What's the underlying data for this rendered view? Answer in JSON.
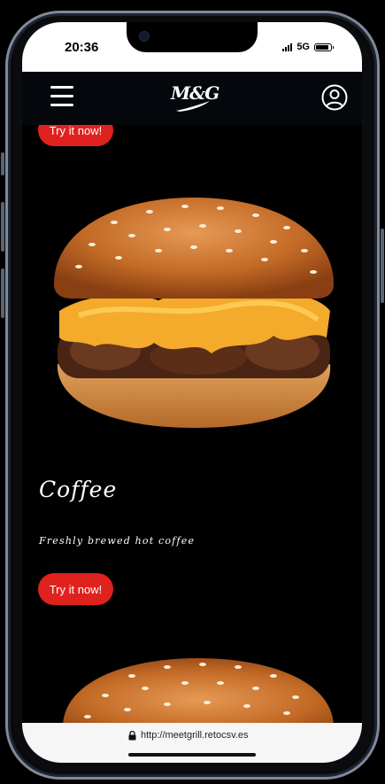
{
  "status_bar": {
    "time": "20:36",
    "network": "5G",
    "battery_level": 0.78
  },
  "navbar": {
    "logo_text": "M&G",
    "menu_icon": "hamburger-menu-icon",
    "account_icon": "user-circle-icon"
  },
  "products": [
    {
      "cta_label": "Try it now!",
      "image": "burger-image"
    },
    {
      "title": "Coffee",
      "description": "Freshly brewed hot coffee",
      "cta_label": "Try it now!",
      "image": "burger-image"
    }
  ],
  "browser": {
    "url": "http://meetgrill.retocsv.es",
    "lock_icon": "lock-icon"
  },
  "colors": {
    "cta": "#e0221f",
    "navbar": "#04070c",
    "background": "#000000"
  }
}
